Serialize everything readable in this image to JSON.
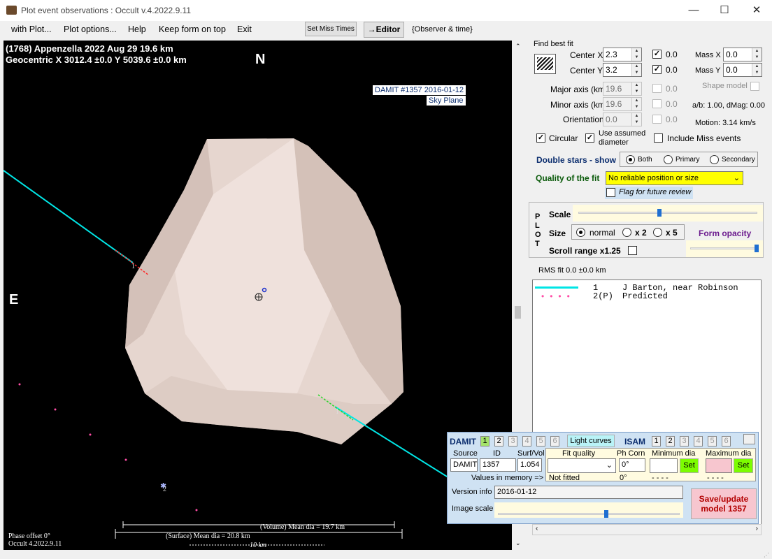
{
  "window": {
    "title": "Plot event observations : Occult v.4.2022.9.11",
    "minimize": "—",
    "maximize": "☐",
    "close": "✕"
  },
  "menu": {
    "items": [
      "with Plot...",
      "Plot options...",
      "Help",
      "Keep form on top",
      "Exit"
    ],
    "set_miss_times": "Set Miss Times",
    "editor": "→Editor",
    "observer_time": "{Observer & time}"
  },
  "plot": {
    "header_line1": "(1768) Appenzella  2022 Aug 29   19.6 km",
    "header_line2": "Geocentric  X  3012.4 ±0.0  Y 5039.6 ±0.0 km",
    "north": "N",
    "east": "E",
    "damit_label": "DAMIT #1357 2016-01-12",
    "sky_plane": "Sky Plane",
    "chord1": "1",
    "chord1b": "1",
    "star2": "2",
    "volume_dia": "(Volume) Mean dia = 19.7 km",
    "surface_dia": "(Surface) Mean dia = 20.8 km",
    "scale_km": "10 km",
    "phase_offset": "Phase offset 0°",
    "version": "Occult 4.2022.9.11"
  },
  "fit": {
    "find_best_fit": "Find best fit",
    "center_x_label": "Center X",
    "center_x": "2.3",
    "center_x_check": "0.0",
    "center_y_label": "Center Y",
    "center_y": "3.2",
    "center_y_check": "0.0",
    "mass_x_label": "Mass X",
    "mass_x": "0.0",
    "mass_y_label": "Mass Y",
    "mass_y": "0.0",
    "major_label": "Major axis (km)",
    "major": "19.6",
    "major_check": "0.0",
    "minor_label": "Minor axis (km)",
    "minor": "19.6",
    "minor_check": "0.0",
    "orient_label": "Orientation",
    "orient": "0.0",
    "orient_check": "0.0",
    "shape_model": "Shape model",
    "ab": "a/b: 1.00, dMag: 0.00",
    "motion": "Motion: 3.14 km/s",
    "circular": "Circular",
    "use_assumed": "Use assumed diameter",
    "include_miss": "Include Miss events",
    "double_stars": "Double stars - show",
    "both": "Both",
    "primary": "Primary",
    "secondary": "Secondary",
    "quality_label": "Quality of the fit",
    "quality_value": "No reliable position or size",
    "flag_review": "Flag for future review"
  },
  "plotbox": {
    "letters": [
      "P",
      "L",
      "O",
      "T"
    ],
    "scale": "Scale",
    "size": "Size",
    "normal": "normal",
    "x2": "x 2",
    "x5": "x 5",
    "form_opacity": "Form opacity",
    "scroll_range": "Scroll range x1.25",
    "scale_level": 0.45,
    "opacity_level": 1.0
  },
  "rms": "RMS fit 0.0 ±0.0 km",
  "legend": [
    {
      "num": "1",
      "name": "J Barton, near Robinson"
    },
    {
      "num": "2(P)",
      "name": "Predicted"
    }
  ],
  "damit": {
    "title": "DAMIT",
    "nums": [
      "1",
      "2",
      "3",
      "4",
      "5",
      "6"
    ],
    "light_curves": "Light curves",
    "isam": "ISAM",
    "source_h": "Source",
    "id_h": "ID",
    "surfvol_h": "Surf/Vol",
    "fitq_h": "Fit quality",
    "phcorr_h": "Ph Corn",
    "mindia_h": "Minimum dia",
    "maxdia_h": "Maximum dia",
    "source": "DAMIT",
    "id": "1357",
    "surfvol": "1.054",
    "phcorr": "0°",
    "set": "Set",
    "values_memory": "Values in memory =>",
    "not_fitted": "Not fitted",
    "phcorr2": "0°",
    "dash": "- - - -",
    "version_label": "Version info",
    "version": "2016-01-12",
    "image_scale": "Image scale",
    "save": "Save/update model 1357",
    "image_scale_level": 0.6
  },
  "colors": {
    "chord": "#00e5e5",
    "asteroid": "#e6d6cf",
    "predicted": "#ff4da6",
    "save_bg": "#f7c6cf",
    "set_bg": "#7cfc00",
    "quality_bg": "#ffff00",
    "max_dia_bg": "#f7c6cf"
  }
}
